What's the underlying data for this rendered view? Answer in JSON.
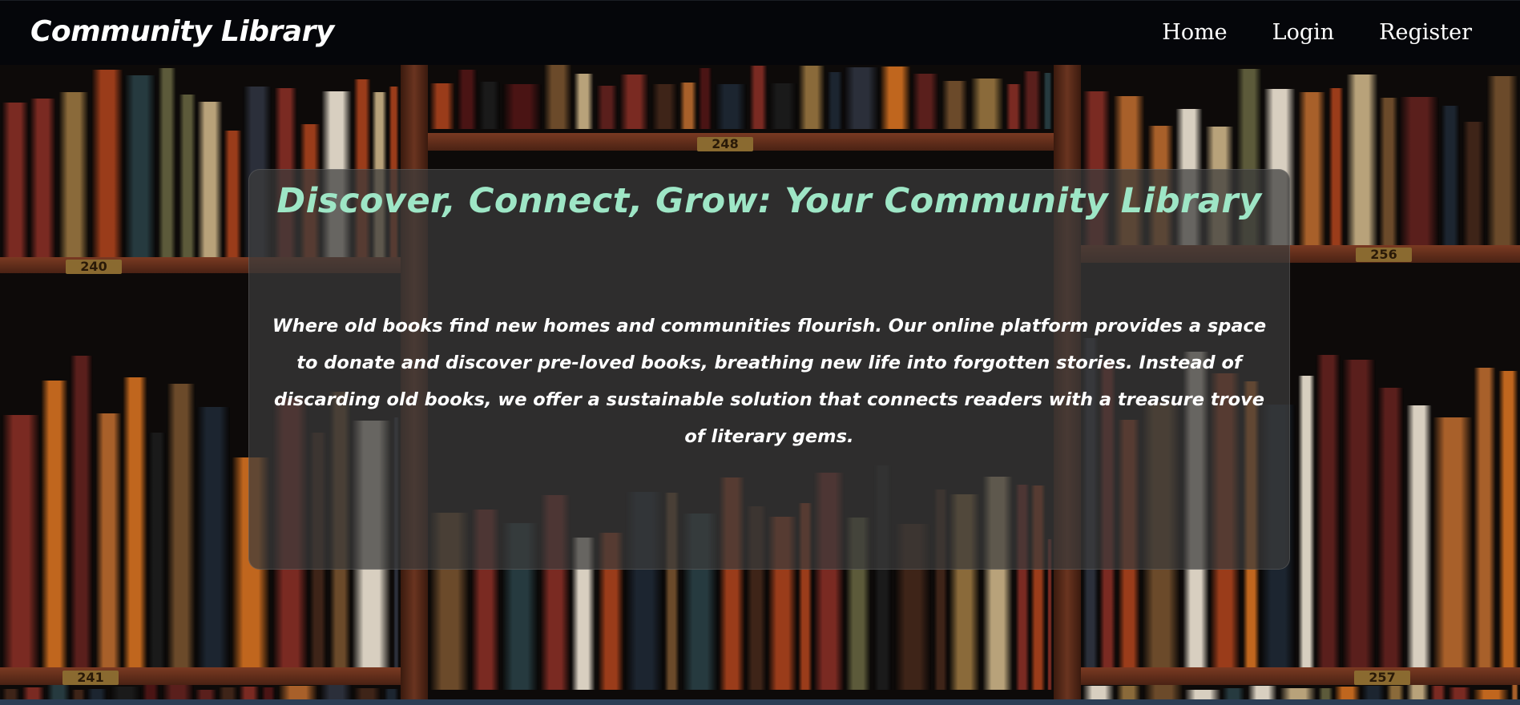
{
  "navbar": {
    "brand": "Community Library",
    "links": [
      {
        "label": "Home"
      },
      {
        "label": "Login"
      },
      {
        "label": "Register"
      }
    ]
  },
  "hero": {
    "title": "Discover, Connect, Grow: Your Community Library",
    "description": "Where old books find new homes and communities flourish. Our online platform provides a space to donate and discover pre-loved books, breathing new life into forgotten stories. Instead of discarding old books, we offer a sustainable solution that connects readers with a treasure trove of literary gems.",
    "shelf_tags": [
      "248",
      "240",
      "256",
      "241",
      "257"
    ]
  },
  "colors": {
    "title_accent": "#9ee6c6",
    "navbar_bg": "#05060a",
    "card_bg": "rgba(60,60,60,0.72)"
  }
}
